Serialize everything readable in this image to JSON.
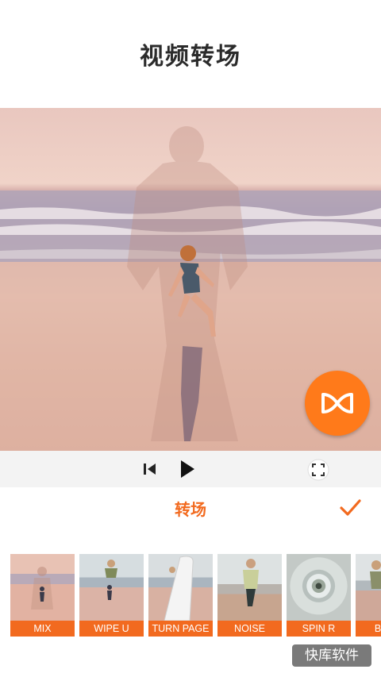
{
  "header": {
    "title": "视频转场"
  },
  "player": {
    "previous_icon": "skip-previous-icon",
    "play_icon": "play-icon",
    "fullscreen_icon": "fullscreen-icon",
    "transition_icon": "transition-bowtie-icon"
  },
  "section": {
    "title": "转场",
    "confirm_icon": "check-icon"
  },
  "transitions": [
    {
      "label": "MIX"
    },
    {
      "label": "WIPE U"
    },
    {
      "label": "TURN PAGE"
    },
    {
      "label": "NOISE"
    },
    {
      "label": "SPIN R"
    },
    {
      "label": "BLUR"
    }
  ],
  "watermark": {
    "text": "快库软件"
  },
  "colors": {
    "accent": "#f26a1f",
    "fab": "#ff7a1a"
  }
}
